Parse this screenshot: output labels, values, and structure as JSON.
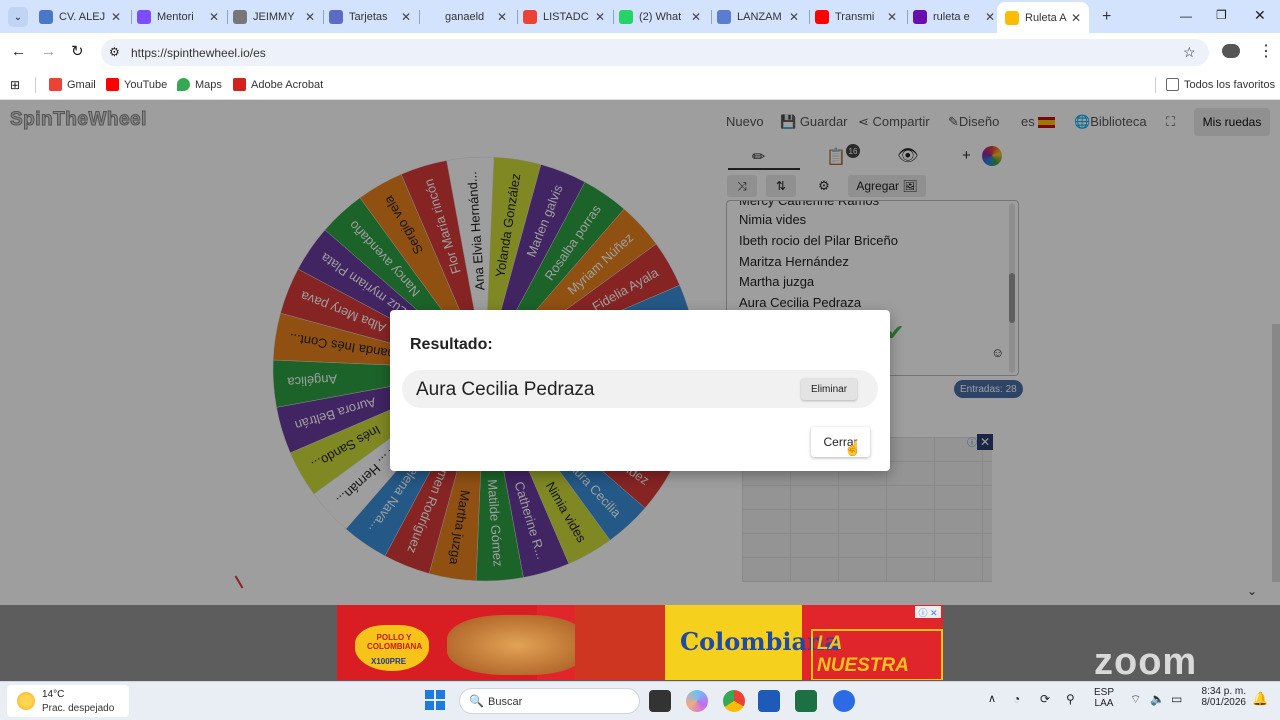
{
  "browser": {
    "tabs": [
      {
        "title": "CV. ALEJ",
        "color": "#4a78c8"
      },
      {
        "title": "Mentori",
        "color": "#7c4dff"
      },
      {
        "title": "JEIMMY",
        "color": "#777777"
      },
      {
        "title": "Tarjetas",
        "color": "#5a6cc4"
      },
      {
        "title": "ganaeld",
        "color": "#d3e3fd"
      },
      {
        "title": "LISTADC",
        "color": "#ea4335"
      },
      {
        "title": "(2) What",
        "color": "#25d366"
      },
      {
        "title": "LANZAM",
        "color": "#5b7ccf"
      },
      {
        "title": "Transmi",
        "color": "#ff0000"
      },
      {
        "title": "ruleta e",
        "color": "#6a0dad"
      },
      {
        "title": "Ruleta A",
        "color": "#fbbc05"
      }
    ],
    "new_tab_label": "+",
    "url": "https://spinthewheel.io/es",
    "bookmarks": [
      {
        "label": "Gmail",
        "color": "#ea4335"
      },
      {
        "label": "YouTube",
        "color": "#ff0000"
      },
      {
        "label": "Maps",
        "color": "#34a853"
      },
      {
        "label": "Adobe Acrobat",
        "color": "#d3211c"
      }
    ],
    "all_bookmarks_label": "Todos los favoritos"
  },
  "app": {
    "logo": "SpinTheWheel",
    "nav": [
      "Nuevo",
      "Guardar",
      "Compartir",
      "Diseño",
      "es",
      "Biblioteca"
    ],
    "my_wheels_label": "Mis ruedas",
    "badge_count": "16",
    "add_label": "Agregar",
    "entries": [
      "Mercy Catherine Ramos",
      "Nimia vides",
      "Ibeth rocio del Pilar Briceño",
      "Maritza Hernández",
      "Martha juzga",
      "Aura Cecilia Pedraza"
    ],
    "entries_count": "Entradas: 28"
  },
  "wheel": {
    "segments": [
      {
        "label": "Ana Elvia Hernánd...",
        "color": "#ffffff",
        "text": "#222222"
      },
      {
        "label": "Yolanda González",
        "color": "#cddc39",
        "text": "#222222"
      },
      {
        "label": "Marlen galvis",
        "color": "#6a3a9e",
        "text": "#ffffff"
      },
      {
        "label": "Rosalba porras",
        "color": "#2ea043",
        "text": "#ffffff"
      },
      {
        "label": "Myriam Núñez",
        "color": "#e8821e",
        "text": "#ffffff"
      },
      {
        "label": "Fidelia Ayala",
        "color": "#d83a3a",
        "text": "#ffffff"
      },
      {
        "label": "Lina Flórez",
        "color": "#3a8fd8",
        "text": "#ffffff"
      },
      {
        "label": "Mercy Catherine",
        "color": "#6a3a9e",
        "text": "#ffffff"
      },
      {
        "label": "Nimia vides",
        "color": "#2ea043",
        "text": "#ffffff"
      },
      {
        "label": "Ibeth rocio del P...",
        "color": "#e8821e",
        "text": "#ffffff"
      },
      {
        "label": "Maritza Hernández",
        "color": "#d83a3a",
        "text": "#ffffff"
      },
      {
        "label": "Aura Cecilia",
        "color": "#3a8fd8",
        "text": "#ffffff"
      },
      {
        "label": "Nimia vides",
        "color": "#cddc39",
        "text": "#222222"
      },
      {
        "label": "Catherine R...",
        "color": "#6a3a9e",
        "text": "#ffffff"
      },
      {
        "label": "Matilde Gómez",
        "color": "#2ea043",
        "text": "#ffffff"
      },
      {
        "label": "Martha juzga",
        "color": "#e8821e",
        "text": "#222222"
      },
      {
        "label": "Carmen Rodríguez",
        "color": "#d83a3a",
        "text": "#ffffff"
      },
      {
        "label": "Helena Nava...",
        "color": "#3a8fd8",
        "text": "#ffffff"
      },
      {
        "label": "Ana ... Hernán...",
        "color": "#ffffff",
        "text": "#222222"
      },
      {
        "label": "Inés Sando...",
        "color": "#cddc39",
        "text": "#222222"
      },
      {
        "label": "Aurora Beltrán",
        "color": "#6a3a9e",
        "text": "#ffffff"
      },
      {
        "label": "Angélica",
        "color": "#2ea043",
        "text": "#ffffff"
      },
      {
        "label": "Fernanda Inés Cont...",
        "color": "#e8821e",
        "text": "#222222"
      },
      {
        "label": "Alba Mery pava",
        "color": "#d83a3a",
        "text": "#ffffff"
      },
      {
        "label": "Luz myriam Plata",
        "color": "#6a3a9e",
        "text": "#ffffff"
      },
      {
        "label": "Nancy avendaño",
        "color": "#2ea043",
        "text": "#ffffff"
      },
      {
        "label": "Sergio vela",
        "color": "#e8821e",
        "text": "#222222"
      },
      {
        "label": "Flor María rincón",
        "color": "#d83a3a",
        "text": "#ffffff"
      }
    ]
  },
  "modal": {
    "title": "Resultado:",
    "result": "Aura Cecilia Pedraza",
    "remove_label": "Eliminar",
    "close_label": "Cerrar"
  },
  "ad": {
    "text1": "POLLO Y COLOMBIANA",
    "text2": "X100PRE",
    "brand": "Colombiana",
    "slogan": "LA NUESTRA"
  },
  "watermark": "zoom",
  "taskbar": {
    "weather_temp": "14°C",
    "weather_desc": "Prac. despejado",
    "search_placeholder": "Buscar",
    "lang1": "ESP",
    "lang2": "LAA",
    "time": "8:34 p. m.",
    "date": "8/01/2026"
  }
}
